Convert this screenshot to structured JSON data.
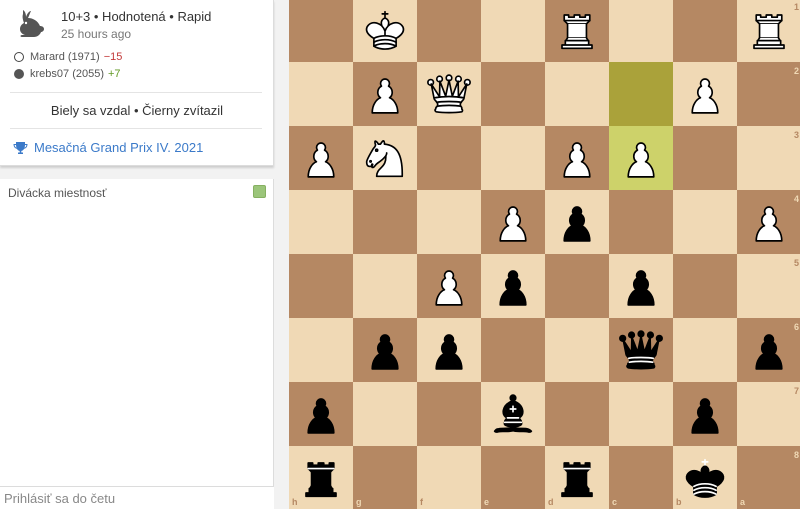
{
  "game": {
    "type": "10+3 • Hodnotená • Rapid",
    "time_ago": "25 hours ago",
    "players": [
      {
        "name": "Marard (1971)",
        "diff": "−15",
        "color": "white"
      },
      {
        "name": "krebs07 (2055)",
        "diff": "+7",
        "color": "black"
      }
    ],
    "result": "Biely sa vzdal • Čierny zvítazil",
    "tournament": "Mesačná Grand Prix IV. 2021",
    "icon": "rabbit-icon"
  },
  "chat": {
    "title": "Divácka miestnosť",
    "input_placeholder": "Prihlásiť sa do četu"
  },
  "board": {
    "orientation": "black",
    "light_color": "#f0d9b5",
    "dark_color": "#b58863",
    "highlight_squares": [
      "c2",
      "c3"
    ],
    "rank_labels": [
      "1",
      "2",
      "3",
      "4",
      "5",
      "6",
      "7",
      "8"
    ],
    "file_labels": [
      "h",
      "g",
      "f",
      "e",
      "d",
      "c",
      "b",
      "a"
    ],
    "pieces": [
      {
        "sq": "g1",
        "piece": "K",
        "color": "w"
      },
      {
        "sq": "d1",
        "piece": "R",
        "color": "w"
      },
      {
        "sq": "a1",
        "piece": "R",
        "color": "w"
      },
      {
        "sq": "g2",
        "piece": "P",
        "color": "w"
      },
      {
        "sq": "f2",
        "piece": "Q",
        "color": "w"
      },
      {
        "sq": "b2",
        "piece": "P",
        "color": "w"
      },
      {
        "sq": "h3",
        "piece": "P",
        "color": "w"
      },
      {
        "sq": "g3",
        "piece": "N",
        "color": "w"
      },
      {
        "sq": "d3",
        "piece": "P",
        "color": "w"
      },
      {
        "sq": "c3",
        "piece": "P",
        "color": "w"
      },
      {
        "sq": "e4",
        "piece": "P",
        "color": "w"
      },
      {
        "sq": "d4",
        "piece": "P",
        "color": "b"
      },
      {
        "sq": "a4",
        "piece": "P",
        "color": "w"
      },
      {
        "sq": "f5",
        "piece": "P",
        "color": "w"
      },
      {
        "sq": "e5",
        "piece": "P",
        "color": "b"
      },
      {
        "sq": "c5",
        "piece": "P",
        "color": "b"
      },
      {
        "sq": "g6",
        "piece": "P",
        "color": "b"
      },
      {
        "sq": "f6",
        "piece": "P",
        "color": "b"
      },
      {
        "sq": "c6",
        "piece": "Q",
        "color": "b"
      },
      {
        "sq": "a6",
        "piece": "P",
        "color": "b"
      },
      {
        "sq": "h7",
        "piece": "P",
        "color": "b"
      },
      {
        "sq": "e7",
        "piece": "B",
        "color": "b"
      },
      {
        "sq": "b7",
        "piece": "P",
        "color": "b"
      },
      {
        "sq": "h8",
        "piece": "R",
        "color": "b"
      },
      {
        "sq": "d8",
        "piece": "R",
        "color": "b"
      },
      {
        "sq": "b8",
        "piece": "K",
        "color": "b"
      }
    ]
  }
}
